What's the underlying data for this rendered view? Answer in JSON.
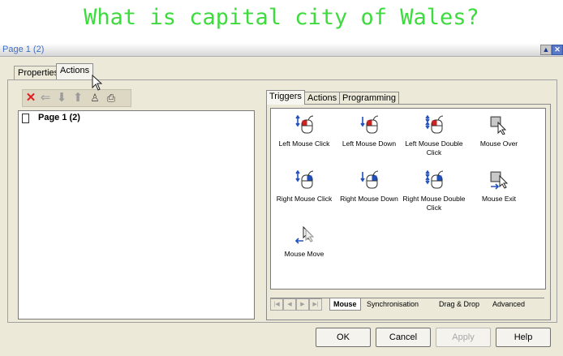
{
  "banner": {
    "text": "What is capital city of Wales?"
  },
  "window": {
    "title": "Page 1 (2)"
  },
  "outer_tabs": {
    "properties": "Properties",
    "actions": "Actions"
  },
  "tree": {
    "root_label": "Page 1 (2)"
  },
  "inner_tabs": {
    "triggers": "Triggers",
    "actions": "Actions",
    "programming": "Programming"
  },
  "triggers": [
    {
      "label": "Left Mouse Click",
      "icon": "left-mouse-click-icon"
    },
    {
      "label": "Left Mouse Down",
      "icon": "left-mouse-down-icon"
    },
    {
      "label": "Left Mouse Double Click",
      "icon": "left-mouse-double-click-icon"
    },
    {
      "label": "Mouse Over",
      "icon": "mouse-over-icon"
    },
    {
      "label": "Right Mouse Click",
      "icon": "right-mouse-click-icon"
    },
    {
      "label": "Right Mouse Down",
      "icon": "right-mouse-down-icon"
    },
    {
      "label": "Right Mouse Double Click",
      "icon": "right-mouse-double-click-icon"
    },
    {
      "label": "Mouse Exit",
      "icon": "mouse-exit-icon"
    },
    {
      "label": "Mouse Move",
      "icon": "mouse-move-icon"
    }
  ],
  "subtabs": {
    "mouse": "Mouse",
    "sync": "Synchronisation",
    "drag": "Drag & Drop",
    "advanced": "Advanced"
  },
  "buttons": {
    "ok": "OK",
    "cancel": "Cancel",
    "apply": "Apply",
    "help": "Help"
  },
  "colors": {
    "banner_text": "#3ddb3d",
    "title_text": "#3a6fc8",
    "delete": "#e02020",
    "mouse_left": "#d02020",
    "mouse_right": "#2050c0"
  }
}
